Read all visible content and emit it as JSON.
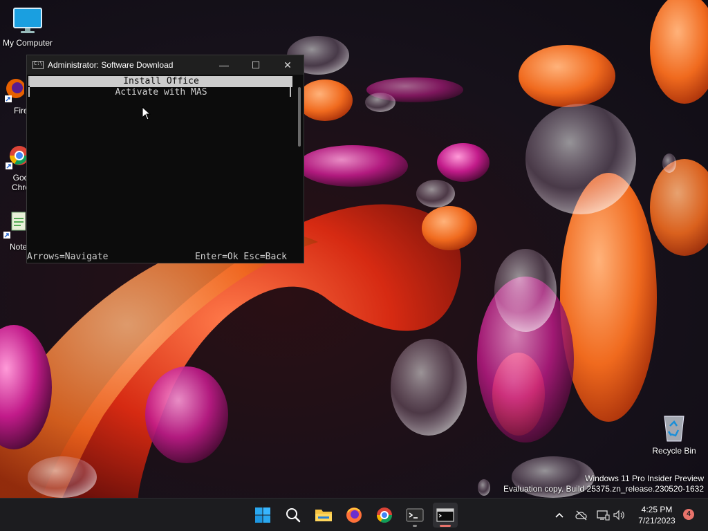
{
  "desktop": {
    "icons": [
      {
        "label": "My Computer"
      },
      {
        "label": "Fire"
      },
      {
        "label": "Goo\nChro"
      },
      {
        "label": "Notep"
      },
      {
        "label": "Recycle Bin"
      }
    ],
    "watermark": {
      "line1": "Windows 11 Pro Insider Preview",
      "line2": "Evaluation copy. Build 25375.zn_release.230520-1632"
    }
  },
  "console": {
    "title": "Administrator:  Software Download",
    "menu": [
      {
        "label": "Install Office",
        "selected": true
      },
      {
        "label": "Activate with MAS",
        "selected": false
      }
    ],
    "footer_left": "Arrows=Navigate",
    "footer_right": "Enter=Ok Esc=Back",
    "controls": {
      "minimize": "—",
      "maximize": "☐",
      "close": "✕"
    }
  },
  "taskbar": {
    "clock_time": "4:25 PM",
    "clock_date": "7/21/2023",
    "notification_count": "4",
    "items": [
      "start",
      "search",
      "file-explorer",
      "firefox",
      "chrome",
      "terminal",
      "console"
    ]
  },
  "colors": {
    "accent": "#e8736b",
    "taskbar": "#1c1c1f",
    "console_bg": "#0c0c0c"
  }
}
